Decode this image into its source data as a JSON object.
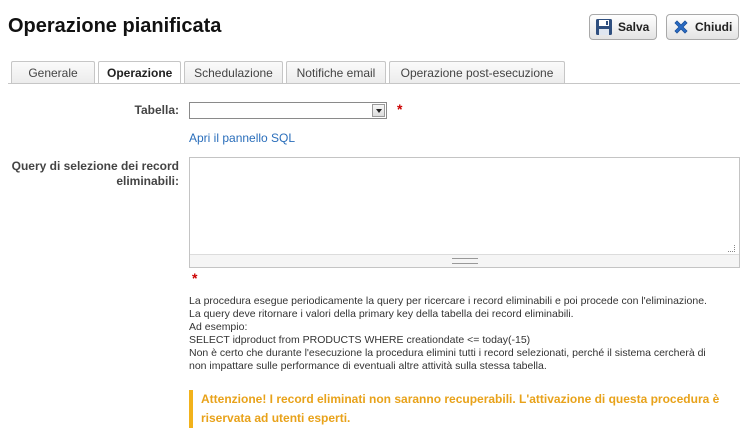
{
  "header": {
    "title": "Operazione pianificata",
    "save_label": "Salva",
    "close_label": "Chiudi"
  },
  "tabs": [
    {
      "label": "Generale",
      "active": false
    },
    {
      "label": "Operazione",
      "active": true
    },
    {
      "label": "Schedulazione",
      "active": false
    },
    {
      "label": "Notifiche email",
      "active": false
    },
    {
      "label": "Operazione post-esecuzione",
      "active": false
    }
  ],
  "form": {
    "table_label": "Tabella:",
    "table_value": "",
    "sql_panel_link": "Apri il pannello SQL",
    "query_label_line1": "Query di selezione dei record",
    "query_label_line2": "eliminabili:",
    "query_value": "",
    "required_marker": "*"
  },
  "help": {
    "lines": [
      "La procedura esegue periodicamente la query per ricercare i record eliminabili e poi procede con l'eliminazione.",
      "La query deve ritornare i valori della primary key della tabella dei record eliminabili.",
      "Ad esempio:",
      "SELECT idproduct from PRODUCTS WHERE creationdate <= today(-15)",
      "Non è certo che durante l'esecuzione la procedura elimini tutti i record selezionati, perché il sistema cercherà di",
      "non impattare sulle performance di eventuali altre attività sulla stessa tabella."
    ]
  },
  "warning": {
    "line1": "Attenzione! I record eliminati non saranno recuperabili. L'attivazione di questa procedura è",
    "line2": "riservata ad utenti esperti."
  },
  "colors": {
    "warning": "#e8a21a",
    "required": "#cc0000",
    "link": "#2a6ebb"
  }
}
